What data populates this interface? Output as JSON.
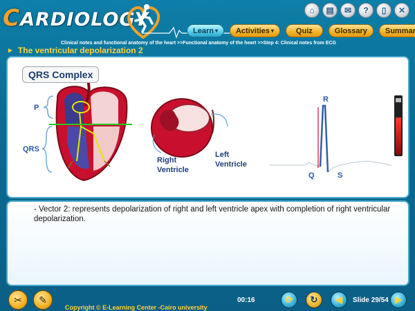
{
  "app": {
    "logo_letter": "C",
    "logo_rest": "ARDIOLOGY"
  },
  "top_icons": [
    {
      "name": "home-icon",
      "glyph": "⌂"
    },
    {
      "name": "print-icon",
      "glyph": "▤"
    },
    {
      "name": "mail-icon",
      "glyph": "✉"
    },
    {
      "name": "help-icon",
      "glyph": "?"
    },
    {
      "name": "notes-icon",
      "glyph": "▯"
    },
    {
      "name": "close-icon",
      "glyph": "✕"
    }
  ],
  "nav": {
    "learn": "Learn",
    "learn_caret": "▾",
    "activities": "Activities",
    "activities_caret": "▾",
    "quiz": "Quiz",
    "glossary": "Glossary",
    "summary": "Summary"
  },
  "breadcrumb": "Clinical notes and functional anatomy of the heart >>Functional anatomy of the heart >>Step 4: Clinical notes from ECG",
  "slide_title": "The ventricular depolarization 2",
  "diagram": {
    "box_title": "QRS Complex",
    "label_p": "P",
    "label_qrs": "QRS",
    "right_ventricle": [
      "Right",
      "Ventricle"
    ],
    "left_ventricle": [
      "Left",
      "Ventricle"
    ],
    "ecg_r": "R",
    "ecg_q": "Q",
    "ecg_s": "S"
  },
  "description": "- Vector 2: represents depolarization of right and left ventricle apex with completion of right ventricular depolarization.",
  "footer": {
    "copyright": "Copyright © E-Learning Center -Cairo university",
    "timer": "00:16",
    "slide": "Slide 29/54"
  },
  "colors": {
    "accent_gold": "#ffd23a",
    "panel_border": "#4aa7cc",
    "background": "#0b6f98"
  }
}
